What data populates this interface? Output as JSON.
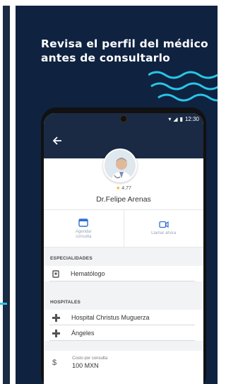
{
  "promo": {
    "headline_line1": "Revisa el perfil del médico",
    "headline_line2": "antes de consultarlo"
  },
  "status_bar": {
    "time": "12:30"
  },
  "doctor": {
    "rating": "4.77",
    "name": "Dr.Felipe Arenas"
  },
  "actions": [
    {
      "label": "Agendar consulta",
      "icon": "calendar-icon"
    },
    {
      "label": "Llamar ahora",
      "icon": "video-call-icon"
    }
  ],
  "sections": {
    "specialties_title": "ESPECIALIDADES",
    "specialties": [
      {
        "label": "Hematólogo",
        "icon": "badge-icon"
      }
    ],
    "hospitals_title": "HOSPITALES",
    "hospitals": [
      {
        "label": "Hospital Christus Muguerza",
        "icon": "hospital-cross-icon"
      },
      {
        "label": "Ángeles",
        "icon": "hospital-cross-icon"
      }
    ],
    "cost": {
      "label": "Costo por consulta",
      "value": "100 MXN",
      "icon": "dollar-icon"
    }
  },
  "colors": {
    "card_bg": "#0f2240",
    "app_bar": "#1a2a44",
    "accent_cyan": "#29c5e6",
    "star": "#f2b01e"
  }
}
